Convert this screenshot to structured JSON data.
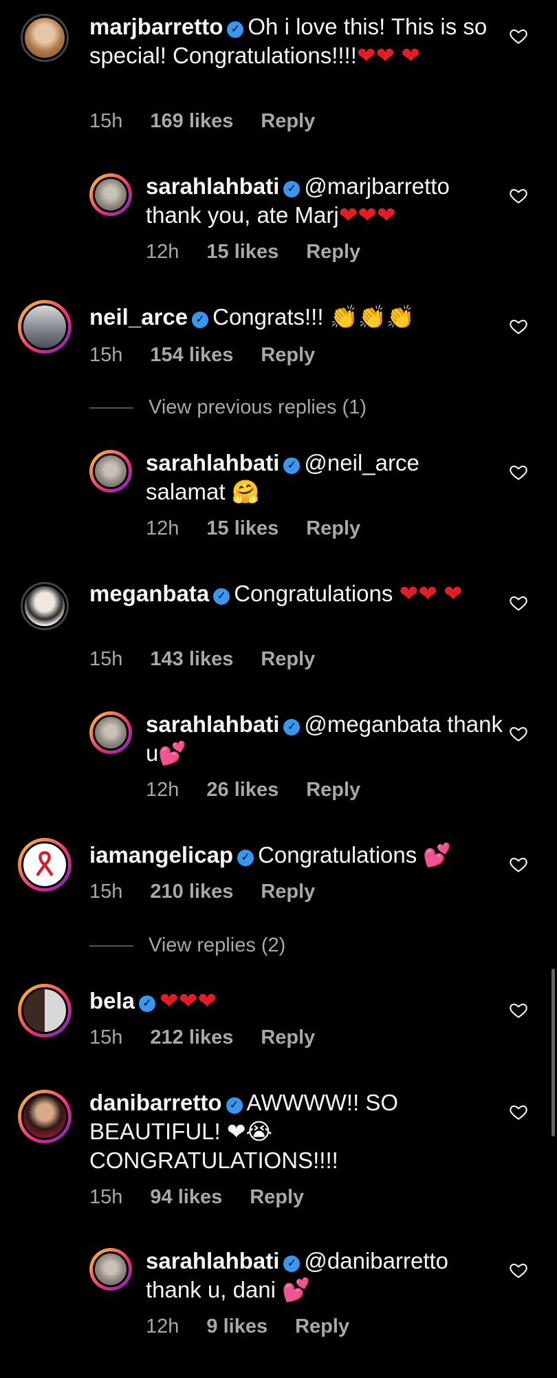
{
  "comments": [
    {
      "user": "marjbarretto",
      "text": "Oh i love this! This is so special! Congratulations!!!!",
      "emoji": "❤❤ ❤",
      "time": "15h",
      "likes": "169 likes",
      "reply": "Reply"
    },
    {
      "user": "sarahlahbati",
      "text": "@marjbarretto thank you, ate Marj",
      "emoji": "❤❤❤",
      "time": "12h",
      "likes": "15 likes",
      "reply": "Reply"
    },
    {
      "user": "neil_arce",
      "text": "Congrats!!!",
      "emoji": "👏👏👏",
      "time": "15h",
      "likes": "154 likes",
      "reply": "Reply"
    },
    {
      "user": "sarahlahbati",
      "text": "@neil_arce salamat",
      "emoji": "🤗",
      "time": "12h",
      "likes": "15 likes",
      "reply": "Reply"
    },
    {
      "user": "meganbata",
      "text": "Congratulations",
      "emoji": "❤❤ ❤",
      "time": "15h",
      "likes": "143 likes",
      "reply": "Reply"
    },
    {
      "user": "sarahlahbati",
      "text": "@meganbata thank u",
      "emoji": "💕",
      "time": "12h",
      "likes": "26 likes",
      "reply": "Reply"
    },
    {
      "user": "iamangelicap",
      "text": "Congratulations",
      "emoji": "💕",
      "time": "15h",
      "likes": "210 likes",
      "reply": "Reply"
    },
    {
      "user": "bela",
      "text": "",
      "emoji": "❤❤❤",
      "time": "15h",
      "likes": "212 likes",
      "reply": "Reply"
    },
    {
      "user": "danibarretto",
      "text": "AWWWW!! SO BEAUTIFUL!",
      "text2": "CONGRATULATIONS!!!!",
      "emoji": "❤😭",
      "time": "15h",
      "likes": "94 likes",
      "reply": "Reply"
    },
    {
      "user": "sarahlahbati",
      "text": "@danibarretto thank u, dani",
      "emoji": "💕",
      "time": "12h",
      "likes": "9 likes",
      "reply": "Reply"
    }
  ],
  "view_previous": "View previous replies (1)",
  "view_replies": "View replies (2)",
  "icons": {
    "heart": "heart-outline-icon",
    "verified": "verified-badge-icon"
  }
}
